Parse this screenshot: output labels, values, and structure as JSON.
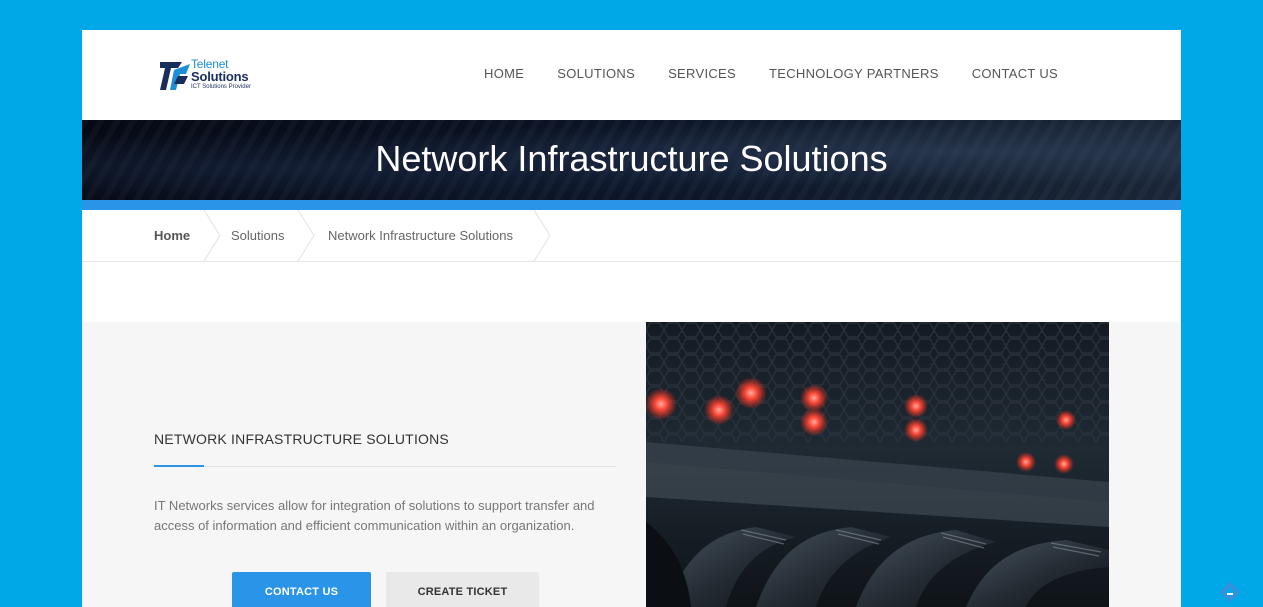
{
  "logo": {
    "line1": "Telenet",
    "line2": "Solutions",
    "line3": "ICT Solutions Provider"
  },
  "nav": {
    "items": [
      "HOME",
      "SOLUTIONS",
      "SERVICES",
      "TECHNOLOGY PARTNERS",
      "CONTACT US"
    ]
  },
  "banner": {
    "title": "Network Infrastructure Solutions"
  },
  "breadcrumb": {
    "items": [
      "Home",
      "Solutions",
      "Network Infrastructure Solutions"
    ]
  },
  "section": {
    "title": "NETWORK INFRASTRUCTURE SOLUTIONS",
    "text": "IT Networks services allow for integration of solutions to support transfer and access of information and efficient communication within an organization.",
    "buttons": {
      "contact": "CONTACT US",
      "ticket": "CREATE TICKET"
    }
  },
  "icons": {
    "image": "network-switch-cables-image",
    "corner": "feedly-icon"
  },
  "colors": {
    "page_background": "#00a8e8",
    "accent": "#2a95e8",
    "banner_dark": "#0b1426"
  }
}
